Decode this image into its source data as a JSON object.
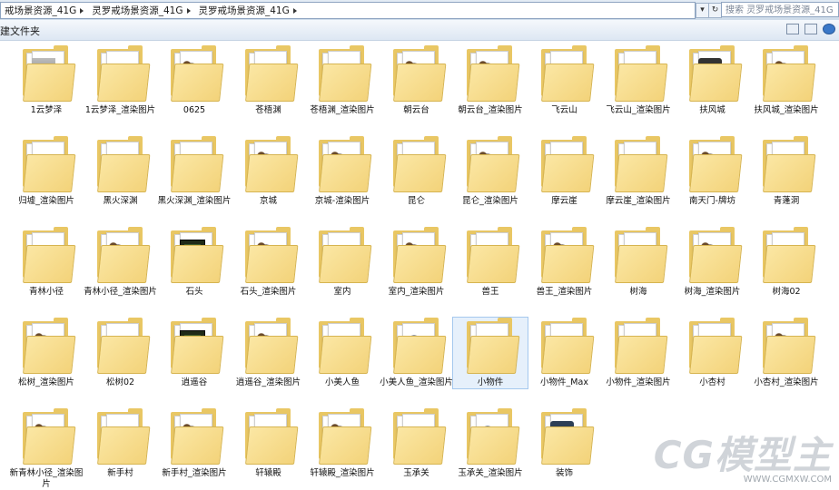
{
  "address": {
    "crumbs": [
      "戒场景资源_41G",
      "灵罗戒场景资源_41G",
      "灵罗戒场景资源_41G"
    ],
    "refresh_icon": "refresh-icon",
    "search_placeholder": "搜索 灵罗戒场景资源_41G"
  },
  "toolbar": {
    "new_folder_label": "建文件夹"
  },
  "items": [
    {
      "name": "1云梦泽",
      "thumb": "stone"
    },
    {
      "name": "1云梦泽_渲染图片",
      "thumb": "light"
    },
    {
      "name": "0625",
      "thumb": "dark"
    },
    {
      "name": "苍梧渊",
      "thumb": "none"
    },
    {
      "name": "苍梧渊_渲染图片",
      "thumb": "light"
    },
    {
      "name": "朝云台",
      "thumb": "dark"
    },
    {
      "name": "朝云台_渲染图片",
      "thumb": "dark"
    },
    {
      "name": "飞云山",
      "thumb": "none"
    },
    {
      "name": "飞云山_渲染图片",
      "thumb": "light"
    },
    {
      "name": "扶风城",
      "thumb": "max"
    },
    {
      "name": "扶风城_渲染图片",
      "thumb": "dark"
    },
    {
      "name": "归墟_渲染图片",
      "thumb": "light"
    },
    {
      "name": "黑火深渊",
      "thumb": "none"
    },
    {
      "name": "黑火深渊_渲染图片",
      "thumb": "light"
    },
    {
      "name": "京城",
      "thumb": "dark"
    },
    {
      "name": "京城-渲染图片",
      "thumb": "dark"
    },
    {
      "name": "昆仑",
      "thumb": "none"
    },
    {
      "name": "昆仑_渲染图片",
      "thumb": "dark"
    },
    {
      "name": "摩云崖",
      "thumb": "none"
    },
    {
      "name": "摩云崖_渲染图片",
      "thumb": "light"
    },
    {
      "name": "南天门-牌坊",
      "thumb": "dark"
    },
    {
      "name": "青蓬洞",
      "thumb": "none"
    },
    {
      "name": "青林小径",
      "thumb": "light"
    },
    {
      "name": "青林小径_渲染图片",
      "thumb": "dark"
    },
    {
      "name": "石头",
      "thumb": "green"
    },
    {
      "name": "石头_渲染图片",
      "thumb": "dark"
    },
    {
      "name": "室内",
      "thumb": "none"
    },
    {
      "name": "室内_渲染图片",
      "thumb": "dark"
    },
    {
      "name": "兽王",
      "thumb": "none"
    },
    {
      "name": "兽王_渲染图片",
      "thumb": "dark"
    },
    {
      "name": "树海",
      "thumb": "none"
    },
    {
      "name": "树海_渲染图片",
      "thumb": "dark"
    },
    {
      "name": "树海02",
      "thumb": "none"
    },
    {
      "name": "松树_渲染图片",
      "thumb": "dark"
    },
    {
      "name": "松树02",
      "thumb": "none"
    },
    {
      "name": "逍遥谷",
      "thumb": "green"
    },
    {
      "name": "逍遥谷_渲染图片",
      "thumb": "dark"
    },
    {
      "name": "小美人鱼",
      "thumb": "none"
    },
    {
      "name": "小美人鱼_渲染图片",
      "thumb": "blue"
    },
    {
      "name": "小物件",
      "thumb": "none",
      "selected": true
    },
    {
      "name": "小物件_Max",
      "thumb": "none"
    },
    {
      "name": "小物件_渲染图片",
      "thumb": "light"
    },
    {
      "name": "小杏村",
      "thumb": "none"
    },
    {
      "name": "小杏村_渲染图片",
      "thumb": "dark"
    },
    {
      "name": "新青林小径_渲染图片",
      "thumb": "dark"
    },
    {
      "name": "新手村",
      "thumb": "none"
    },
    {
      "name": "新手村_渲染图片",
      "thumb": "dark"
    },
    {
      "name": "轩辕殿",
      "thumb": "none"
    },
    {
      "name": "轩辕殿_渲染图片",
      "thumb": "dark"
    },
    {
      "name": "玉承关",
      "thumb": "none"
    },
    {
      "name": "玉承关_渲染图片",
      "thumb": "blue"
    },
    {
      "name": "装饰",
      "thumb": "app"
    }
  ],
  "watermark": {
    "logo": "CG模型主",
    "url": "WWW.CGMXW.COM"
  },
  "colors": {
    "folder": "#f3d37a",
    "selection": "#e6f0fb",
    "toolbar": "#dde7f3"
  }
}
